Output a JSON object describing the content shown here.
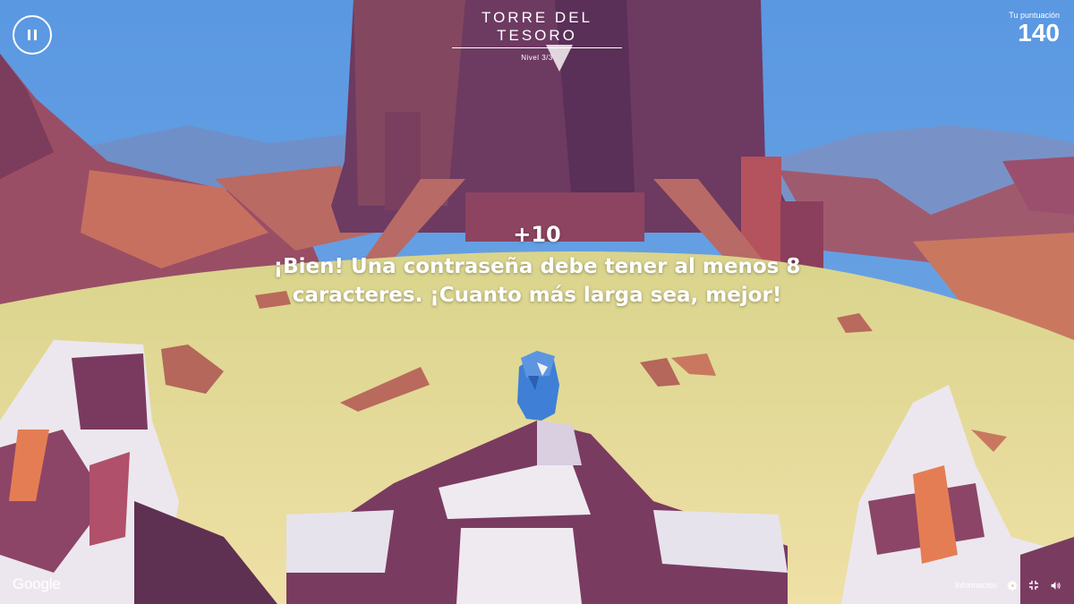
{
  "game": {
    "title": "TORRE DEL TESORO",
    "level": "Nivel   3/3"
  },
  "score": {
    "label": "Tu puntuación",
    "value": "140"
  },
  "feedback": {
    "points": "+10",
    "message": "¡Bien! Una contraseña debe tener al menos 8 caracteres. ¡Cuanto más larga sea, mejor!"
  },
  "footer": {
    "brand": "Google",
    "info_label": "Información"
  },
  "icons": {
    "pause": "pause-icon",
    "settings": "gear-icon",
    "fullscreen": "fullscreen-exit-icon",
    "sound": "speaker-icon"
  },
  "colors": {
    "sky": "#5f9be0",
    "ground": "#e6dc98",
    "tower": "#6d3a62",
    "character": "#3f7fd6"
  }
}
